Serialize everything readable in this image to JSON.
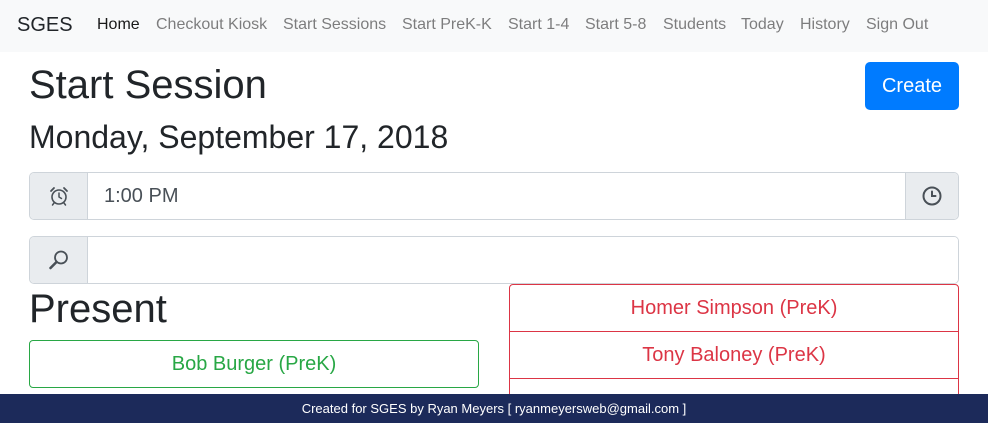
{
  "navbar": {
    "brand": "SGES",
    "items": [
      {
        "label": "Home",
        "active": true
      },
      {
        "label": "Checkout Kiosk"
      },
      {
        "label": "Start Sessions"
      },
      {
        "label": "Start PreK-K"
      },
      {
        "label": "Start 1-4"
      },
      {
        "label": "Start 5-8"
      },
      {
        "label": "Students"
      },
      {
        "label": "Today"
      },
      {
        "label": "History"
      },
      {
        "label": "Sign Out"
      }
    ]
  },
  "page": {
    "title": "Start Session",
    "create_label": "Create",
    "date": "Monday, September 17, 2018"
  },
  "time_input": {
    "value": "1:00 PM",
    "left_icon": "alarm-clock-icon",
    "right_icon": "clock-icon"
  },
  "search_input": {
    "value": "",
    "icon": "magnifier-icon"
  },
  "present": {
    "heading": "Present",
    "students": [
      "Bob Burger (PreK)"
    ]
  },
  "absent": {
    "students": [
      "Homer Simpson (PreK)",
      "Tony Baloney (PreK)",
      ""
    ]
  },
  "footer": {
    "text": "Created for SGES by Ryan Meyers [ ryanmeyersweb@gmail.com ]"
  },
  "colors": {
    "primary": "#007bff",
    "present": "#28a745",
    "absent": "#dc3545",
    "footer_bg": "#1c2a5a"
  }
}
